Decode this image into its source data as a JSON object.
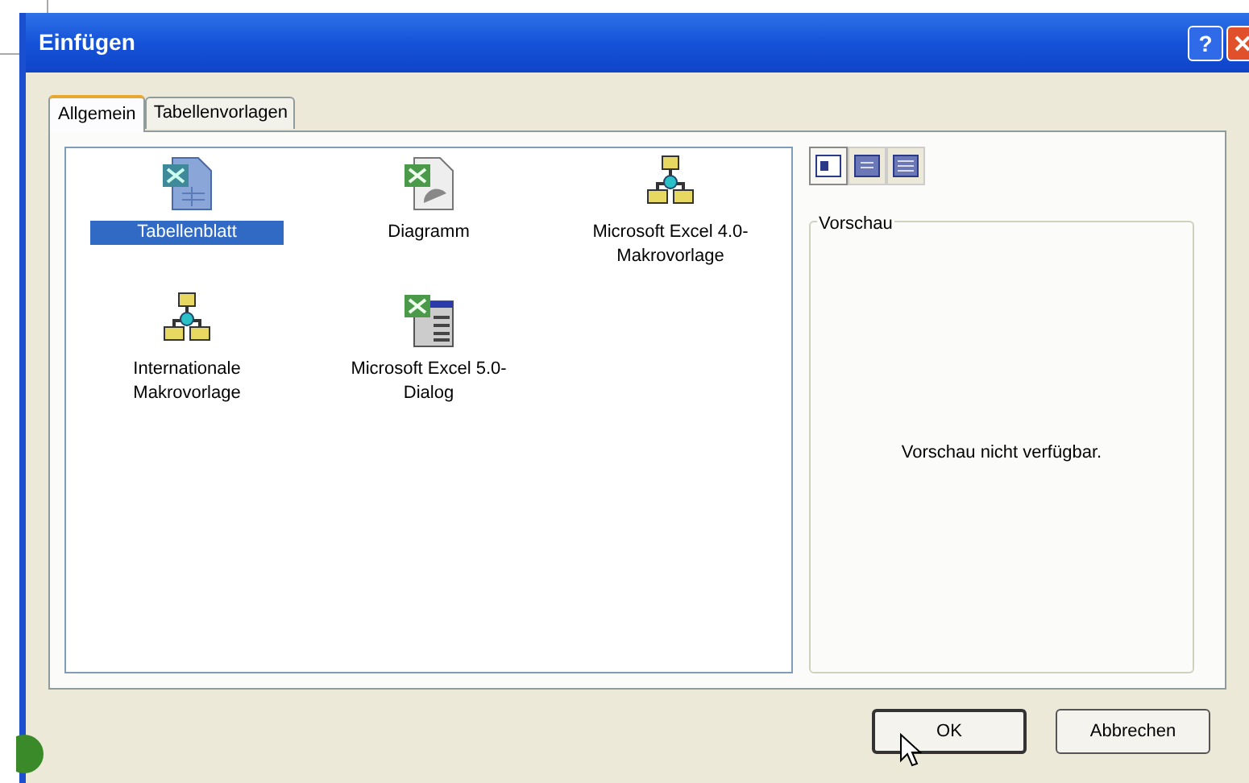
{
  "window": {
    "title": "Einfügen",
    "help": "?"
  },
  "tabs": [
    {
      "label": "Allgemein",
      "selected": true
    },
    {
      "label": "Tabellenvorlagen",
      "selected": false
    }
  ],
  "items": [
    {
      "kind": "sheet",
      "label": "Tabellenblatt",
      "selected": true
    },
    {
      "kind": "chart",
      "label": "Diagramm",
      "selected": false
    },
    {
      "kind": "macro",
      "label": "Microsoft Excel 4.0-Makrovorlage",
      "selected": false
    },
    {
      "kind": "macro",
      "label": "Internationale Makrovorlage",
      "selected": false
    },
    {
      "kind": "dialog",
      "label": "Microsoft Excel 5.0-Dialog",
      "selected": false
    }
  ],
  "view_buttons": [
    {
      "kind": "large",
      "selected": true
    },
    {
      "kind": "list",
      "selected": false
    },
    {
      "kind": "details",
      "selected": false
    }
  ],
  "preview": {
    "title": "Vorschau",
    "message": "Vorschau nicht verfügbar."
  },
  "buttons": [
    "OK",
    "Abbrechen"
  ]
}
